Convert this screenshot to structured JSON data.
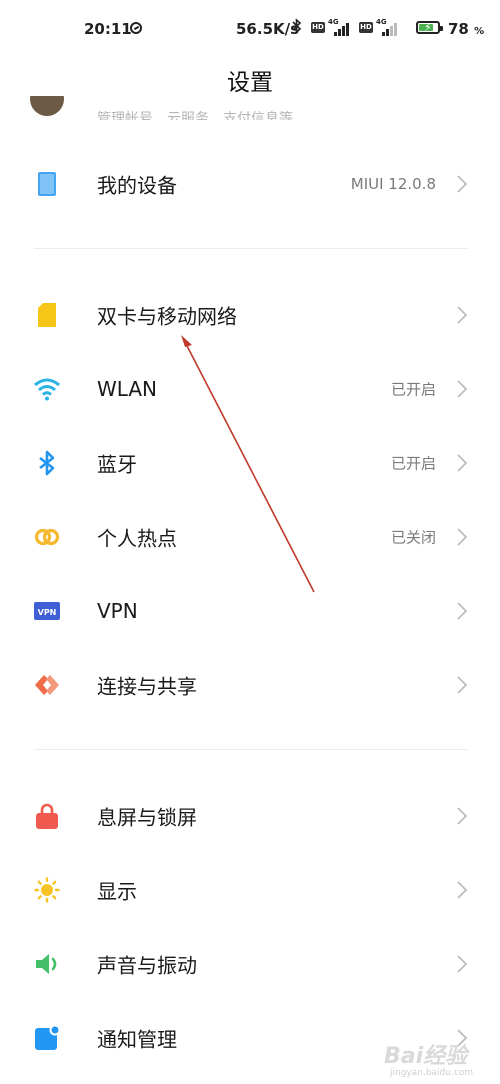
{
  "status_bar": {
    "time": "20:11",
    "speed": "56.5K/s",
    "hd_label": "HD",
    "network_label": "4G",
    "battery_percent": "78",
    "battery_unit": "%",
    "battery_level": 0.78,
    "battery_color": "#4caf50"
  },
  "header": {
    "title": "设置"
  },
  "account": {
    "subtitle": "管理帐号、云服务、支付信息等"
  },
  "device": {
    "label": "我的设备",
    "value": "MIUI 12.0.8"
  },
  "network_section": [
    {
      "id": "sim",
      "label": "双卡与移动网络",
      "value": "",
      "icon": "sim-card-icon",
      "color": "#f5c518"
    },
    {
      "id": "wlan",
      "label": "WLAN",
      "value": "已开启",
      "icon": "wifi-icon",
      "color": "#2bb3e6"
    },
    {
      "id": "bluetooth",
      "label": "蓝牙",
      "value": "已开启",
      "icon": "bluetooth-icon",
      "color": "#2196f3"
    },
    {
      "id": "hotspot",
      "label": "个人热点",
      "value": "已关闭",
      "icon": "hotspot-icon",
      "color": "#f5b82e"
    },
    {
      "id": "vpn",
      "label": "VPN",
      "value": "",
      "icon": "vpn-icon",
      "color": "#3f5fd6"
    },
    {
      "id": "share",
      "label": "连接与共享",
      "value": "",
      "icon": "connection-share-icon",
      "color": "#ef6c47"
    }
  ],
  "display_section": [
    {
      "id": "lock",
      "label": "息屏与锁屏",
      "icon": "lock-icon",
      "color": "#f05a4f"
    },
    {
      "id": "display",
      "label": "显示",
      "icon": "sun-icon",
      "color": "#f7c325"
    },
    {
      "id": "sound",
      "label": "声音与振动",
      "icon": "speaker-icon",
      "color": "#43c067"
    },
    {
      "id": "notify",
      "label": "通知管理",
      "icon": "notification-icon",
      "color": "#2196f3"
    }
  ],
  "vpn_badge": "VPN",
  "watermark": {
    "text": "Bai经验",
    "sub": "jingyan.baidu.com"
  },
  "annotation_arrow_color": "#c0392b"
}
